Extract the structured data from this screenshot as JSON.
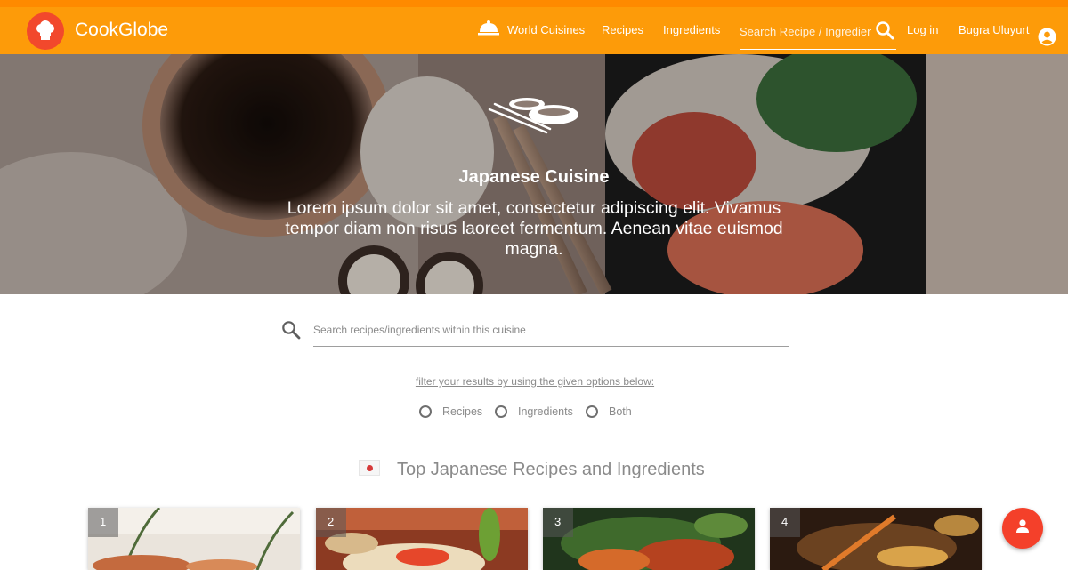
{
  "app": {
    "brand": "CookGlobe",
    "accent": "#fd9b09",
    "logo_color": "#f2482c",
    "logo_icon": "chef-hat-icon"
  },
  "nav": {
    "world_cuisines": "World Cuisines",
    "world_cuisines_icon": "cloche-icon",
    "recipes": "Recipes",
    "ingredients": "Ingredients",
    "search_placeholder": "Search Recipe / Ingredient",
    "search_icon": "search-icon",
    "login": "Log in",
    "user_name": "Bugra Uluyurt",
    "user_icon": "account-circle-icon"
  },
  "hero": {
    "icon": "bowls-chopsticks-icon",
    "title": "Japanese Cuisine",
    "description": "Lorem ipsum dolor sit amet, consectetur adipiscing elit. Vivamus tempor diam non risus laoreet fermentum. Aenean vitae euismod magna."
  },
  "cuisine_search": {
    "placeholder": "Search recipes/ingredients within this cuisine",
    "icon": "search-icon"
  },
  "filter": {
    "text": "filter your results by using the given options below:",
    "options": [
      "Recipes",
      "Ingredients",
      "Both"
    ]
  },
  "section": {
    "flag": "japan-flag-icon",
    "title": "Top Japanese Recipes and Ingredients"
  },
  "cards": [
    {
      "rank": "1"
    },
    {
      "rank": "2"
    },
    {
      "rank": "3"
    },
    {
      "rank": "4"
    }
  ],
  "fab": {
    "icon": "person-icon",
    "color": "#f4402a"
  }
}
